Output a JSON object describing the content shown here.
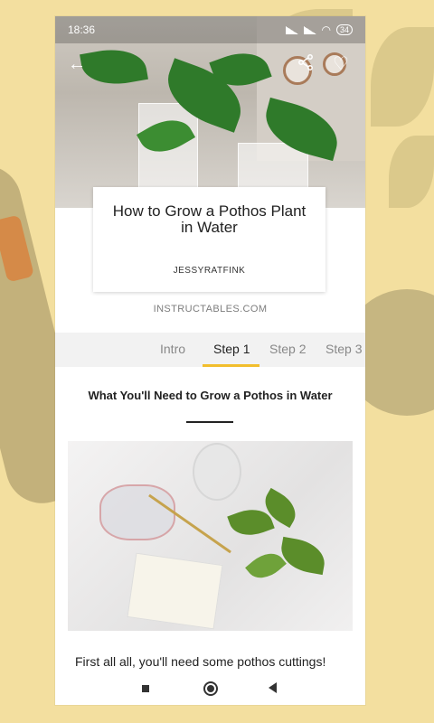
{
  "statusbar": {
    "time": "18:36",
    "battery": "34"
  },
  "header": {
    "back_icon": "arrow-left-icon",
    "share_icon": "share-icon",
    "favorite_icon": "heart-icon"
  },
  "project": {
    "title": "How to Grow a Pothos Plant in Water",
    "author": "JESSYRATFINK",
    "site": "INSTRUCTABLES.COM"
  },
  "tabs": [
    {
      "label": "Intro"
    },
    {
      "label": "Step 1",
      "active": true
    },
    {
      "label": "Step 2"
    },
    {
      "label": "Step 3"
    }
  ],
  "step": {
    "title": "What You'll Need to Grow a Pothos in Water",
    "text": "First all all, you'll need some pothos cuttings!"
  },
  "colors": {
    "accent": "#f2be2d",
    "background": "#f3df9f"
  }
}
